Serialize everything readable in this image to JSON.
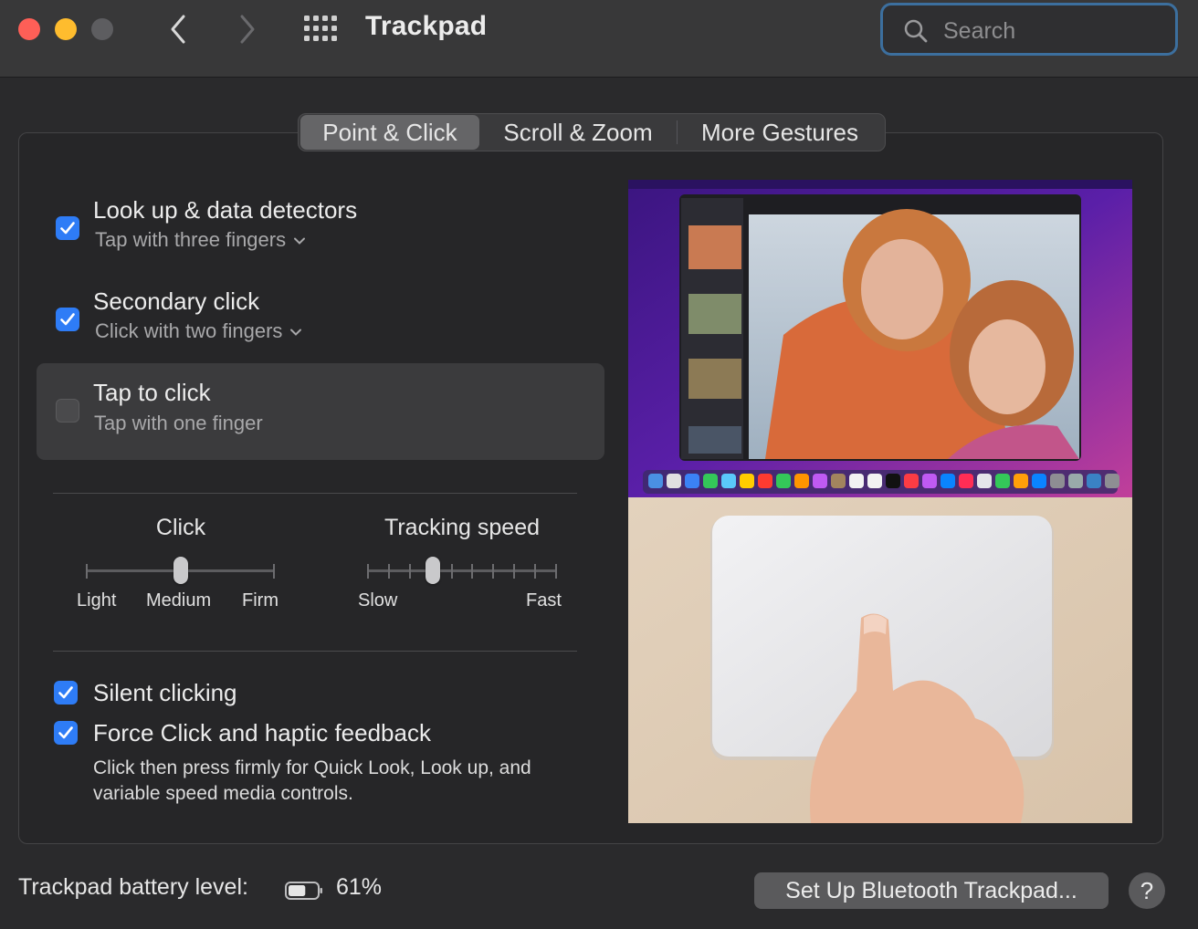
{
  "window": {
    "title": "Trackpad",
    "search_placeholder": "Search"
  },
  "tabs": [
    {
      "label": "Point & Click",
      "selected": true
    },
    {
      "label": "Scroll & Zoom",
      "selected": false
    },
    {
      "label": "More Gestures",
      "selected": false
    }
  ],
  "options": [
    {
      "title": "Look up & data detectors",
      "subtitle": "Tap with three fingers",
      "checked": true,
      "has_dropdown": true
    },
    {
      "title": "Secondary click",
      "subtitle": "Click with two fingers",
      "checked": true,
      "has_dropdown": true
    },
    {
      "title": "Tap to click",
      "subtitle": "Tap with one finger",
      "checked": false,
      "has_dropdown": false
    }
  ],
  "click_slider": {
    "title": "Click",
    "labels": [
      "Light",
      "Medium",
      "Firm"
    ],
    "value": "Medium",
    "position": 0.5
  },
  "tracking_slider": {
    "title": "Tracking speed",
    "labels": [
      "Slow",
      "Fast"
    ],
    "position": 0.35
  },
  "bottom_options": [
    {
      "title": "Silent clicking",
      "checked": true
    },
    {
      "title": "Force Click and haptic feedback",
      "checked": true,
      "description": "Click then press firmly for Quick Look, Look up, and variable speed media controls."
    }
  ],
  "footer": {
    "battery_label": "Trackpad battery level:",
    "battery_percent": "61%",
    "battery_level": 0.61,
    "setup_button": "Set Up Bluetooth Trackpad...",
    "help_button": "?"
  },
  "colors": {
    "accent": "#2e7cf6",
    "close": "#fe5f57",
    "minimize": "#febc2e",
    "search_focus": "#3c6f9e"
  }
}
